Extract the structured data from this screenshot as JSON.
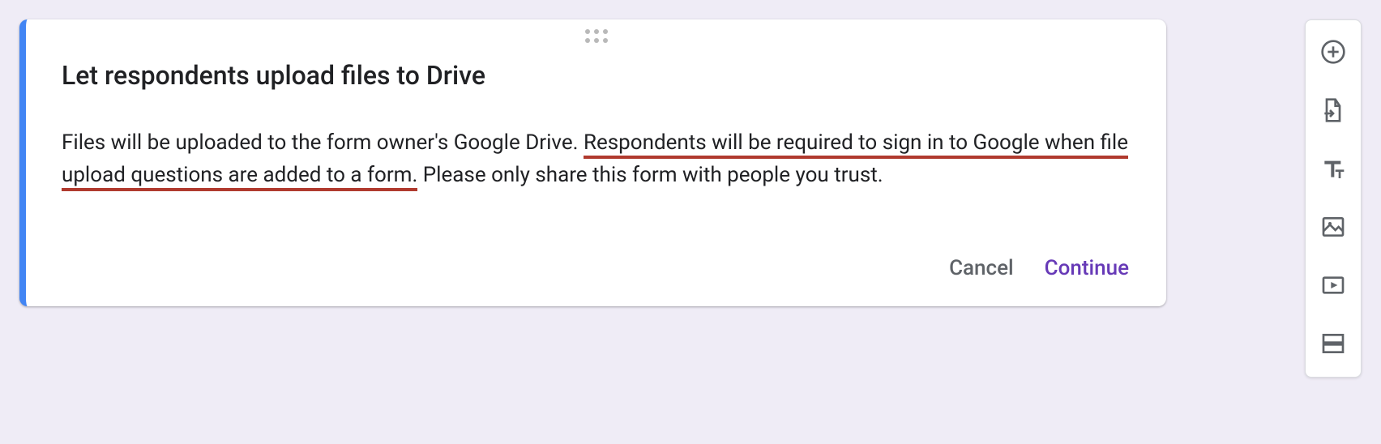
{
  "card": {
    "title": "Let respondents upload files to Drive",
    "body_plain": "Files will be uploaded to the form owner's Google Drive. ",
    "body_underlined": "Respondents will be required to sign in to Google when file upload questions are added to a form.",
    "body_tail": " Please only share this form with people you trust.",
    "cancel_label": "Cancel",
    "continue_label": "Continue"
  },
  "toolbar": {
    "add_question": "add-question",
    "import_questions": "import-questions",
    "add_title": "add-title-and-description",
    "add_image": "add-image",
    "add_video": "add-video",
    "add_section": "add-section"
  }
}
